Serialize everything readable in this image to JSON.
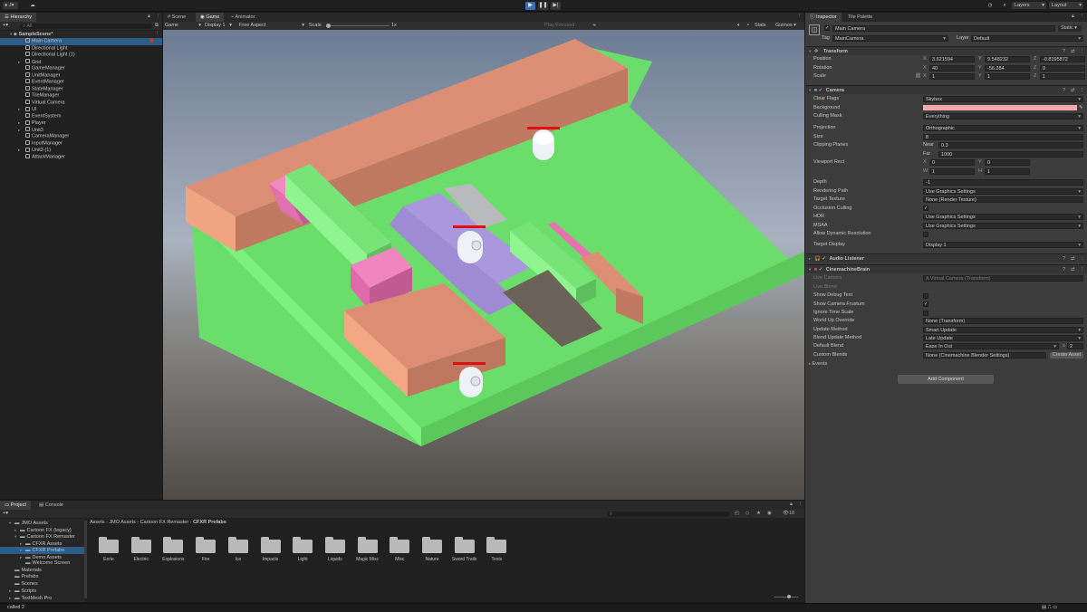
{
  "toolbar": {
    "account": "J",
    "layers": "Layers",
    "layout": "Layout"
  },
  "hierarchy": {
    "tab": "Hierarchy",
    "search_placeholder": "All",
    "scene": "SampleScene*",
    "items": [
      {
        "label": "Main Camera",
        "expand": false,
        "depth": 2
      },
      {
        "label": "Directional Light",
        "expand": false,
        "depth": 2
      },
      {
        "label": "Directional Light (1)",
        "expand": false,
        "depth": 2
      },
      {
        "label": "Grid",
        "expand": true,
        "depth": 2
      },
      {
        "label": "GameManager",
        "expand": false,
        "depth": 2
      },
      {
        "label": "UnitManager",
        "expand": false,
        "depth": 2
      },
      {
        "label": "EventManager",
        "expand": false,
        "depth": 2
      },
      {
        "label": "StateManager",
        "expand": false,
        "depth": 2
      },
      {
        "label": "TileManager",
        "expand": false,
        "depth": 2
      },
      {
        "label": "Virtual Camera",
        "expand": false,
        "depth": 2
      },
      {
        "label": "UI",
        "expand": true,
        "depth": 2
      },
      {
        "label": "EventSystem",
        "expand": false,
        "depth": 2
      },
      {
        "label": "Player",
        "expand": true,
        "depth": 2
      },
      {
        "label": "Unit3",
        "expand": true,
        "depth": 2
      },
      {
        "label": "CameraManager",
        "expand": false,
        "depth": 2
      },
      {
        "label": "InputManager",
        "expand": false,
        "depth": 2
      },
      {
        "label": "Unit3 (1)",
        "expand": true,
        "depth": 2
      },
      {
        "label": "AttackManager",
        "expand": false,
        "depth": 2
      }
    ]
  },
  "game": {
    "tabs": [
      "Scene",
      "Game",
      "Animator"
    ],
    "mode": "Game",
    "display": "Display 1",
    "aspect": "Free Aspect",
    "scale_label": "Scale",
    "scale_value": "1x",
    "play_focused": "Play Focused",
    "stats": "Stats",
    "gizmos": "Gizmos"
  },
  "inspector": {
    "tabs": [
      "Inspector",
      "Tile Palette"
    ],
    "object_name": "Main Camera",
    "static": "Static",
    "tag_label": "Tag",
    "tag": "MainCamera",
    "layer_label": "Layer",
    "layer": "Default",
    "transform": {
      "title": "Transform",
      "position_label": "Position",
      "position": [
        "3.621594",
        "9.548232",
        "-0.8195872"
      ],
      "rotation_label": "Rotation",
      "rotation": [
        "40",
        "-56.284",
        "0"
      ],
      "scale_label": "Scale",
      "scale": [
        "1",
        "1",
        "1"
      ],
      "axes": [
        "X",
        "Y",
        "Z"
      ]
    },
    "camera": {
      "title": "Camera",
      "clear_flags_label": "Clear Flags",
      "clear_flags": "Skybox",
      "background_label": "Background",
      "background_color": "#f4a9b0",
      "culling_mask_label": "Culling Mask",
      "culling_mask": "Everything",
      "projection_label": "Projection",
      "projection": "Orthographic",
      "size_label": "Size",
      "size": "8",
      "clipping_label": "Clipping Planes",
      "near_label": "Near",
      "near": "0.3",
      "far_label": "Far",
      "far": "1000",
      "viewport_label": "Viewport Rect",
      "vx": "0",
      "vy": "0",
      "vw": "1",
      "vh": "1",
      "depth_label": "Depth",
      "depth": "-1",
      "rendering_path_label": "Rendering Path",
      "rendering_path": "Use Graphics Settings",
      "target_texture_label": "Target Texture",
      "target_texture": "None (Render Texture)",
      "occlusion_label": "Occlusion Culling",
      "hdr_label": "HDR",
      "hdr": "Use Graphics Settings",
      "msaa_label": "MSAA",
      "msaa": "Use Graphics Settings",
      "dynres_label": "Allow Dynamic Resolution",
      "target_display_label": "Target Display",
      "target_display": "Display 1"
    },
    "audio": {
      "title": "Audio Listener"
    },
    "brain": {
      "title": "CinemachineBrain",
      "live_camera_label": "Live Camera",
      "live_camera": "A Virtual Camera (Transform)",
      "live_blend_label": "Live Blend",
      "debug_label": "Show Debug Text",
      "frustum_label": "Show Camera Frustum",
      "ignore_time_label": "Ignore Time Scale",
      "world_up_label": "World Up Override",
      "world_up": "None (Transform)",
      "update_method_label": "Update Method",
      "update_method": "Smart Update",
      "blend_update_label": "Blend Update Method",
      "blend_update": "Late Update",
      "default_blend_label": "Default Blend",
      "default_blend": "Ease In Out",
      "blend_s": "s",
      "blend_time": "2",
      "custom_blends_label": "Custom Blends",
      "custom_blends": "None (Cinemachine Blender Settings)",
      "create_asset": "Create Asset",
      "events_label": "Events"
    },
    "add_component": "Add Component"
  },
  "project": {
    "tabs": [
      "Project",
      "Console"
    ],
    "tree": [
      {
        "label": "JMO Assets",
        "indent": 1,
        "arrow": "▾"
      },
      {
        "label": "Cartoon FX (legacy)",
        "indent": 2,
        "arrow": "▸"
      },
      {
        "label": "Cartoon FX Remaster",
        "indent": 2,
        "arrow": "▾"
      },
      {
        "label": "CFXR Assets",
        "indent": 3,
        "arrow": "▸"
      },
      {
        "label": "CFXR Prefabs",
        "indent": 3,
        "arrow": "▸",
        "selected": true
      },
      {
        "label": "Demo Assets",
        "indent": 3,
        "arrow": "▸"
      },
      {
        "label": "Welcome Screen",
        "indent": 3,
        "arrow": ""
      },
      {
        "label": "Materials",
        "indent": 1,
        "arrow": ""
      },
      {
        "label": "Prefabs",
        "indent": 1,
        "arrow": ""
      },
      {
        "label": "Scenes",
        "indent": 1,
        "arrow": ""
      },
      {
        "label": "Scripts",
        "indent": 1,
        "arrow": "▸"
      },
      {
        "label": "TextMesh Pro",
        "indent": 1,
        "arrow": "▸"
      }
    ],
    "breadcrumb": [
      "Assets",
      "JMO Assets",
      "Cartoon FX Remaster",
      "CFXR Prefabs"
    ],
    "folders": [
      "Eerie",
      "Electric",
      "Explosions",
      "Fire",
      "Ice",
      "Impacts",
      "Light",
      "Liquids",
      "Magic Misc",
      "Misc",
      "Nature",
      "Sword Trails",
      "Texts"
    ],
    "count": "18"
  },
  "status": {
    "text": "called 2"
  }
}
